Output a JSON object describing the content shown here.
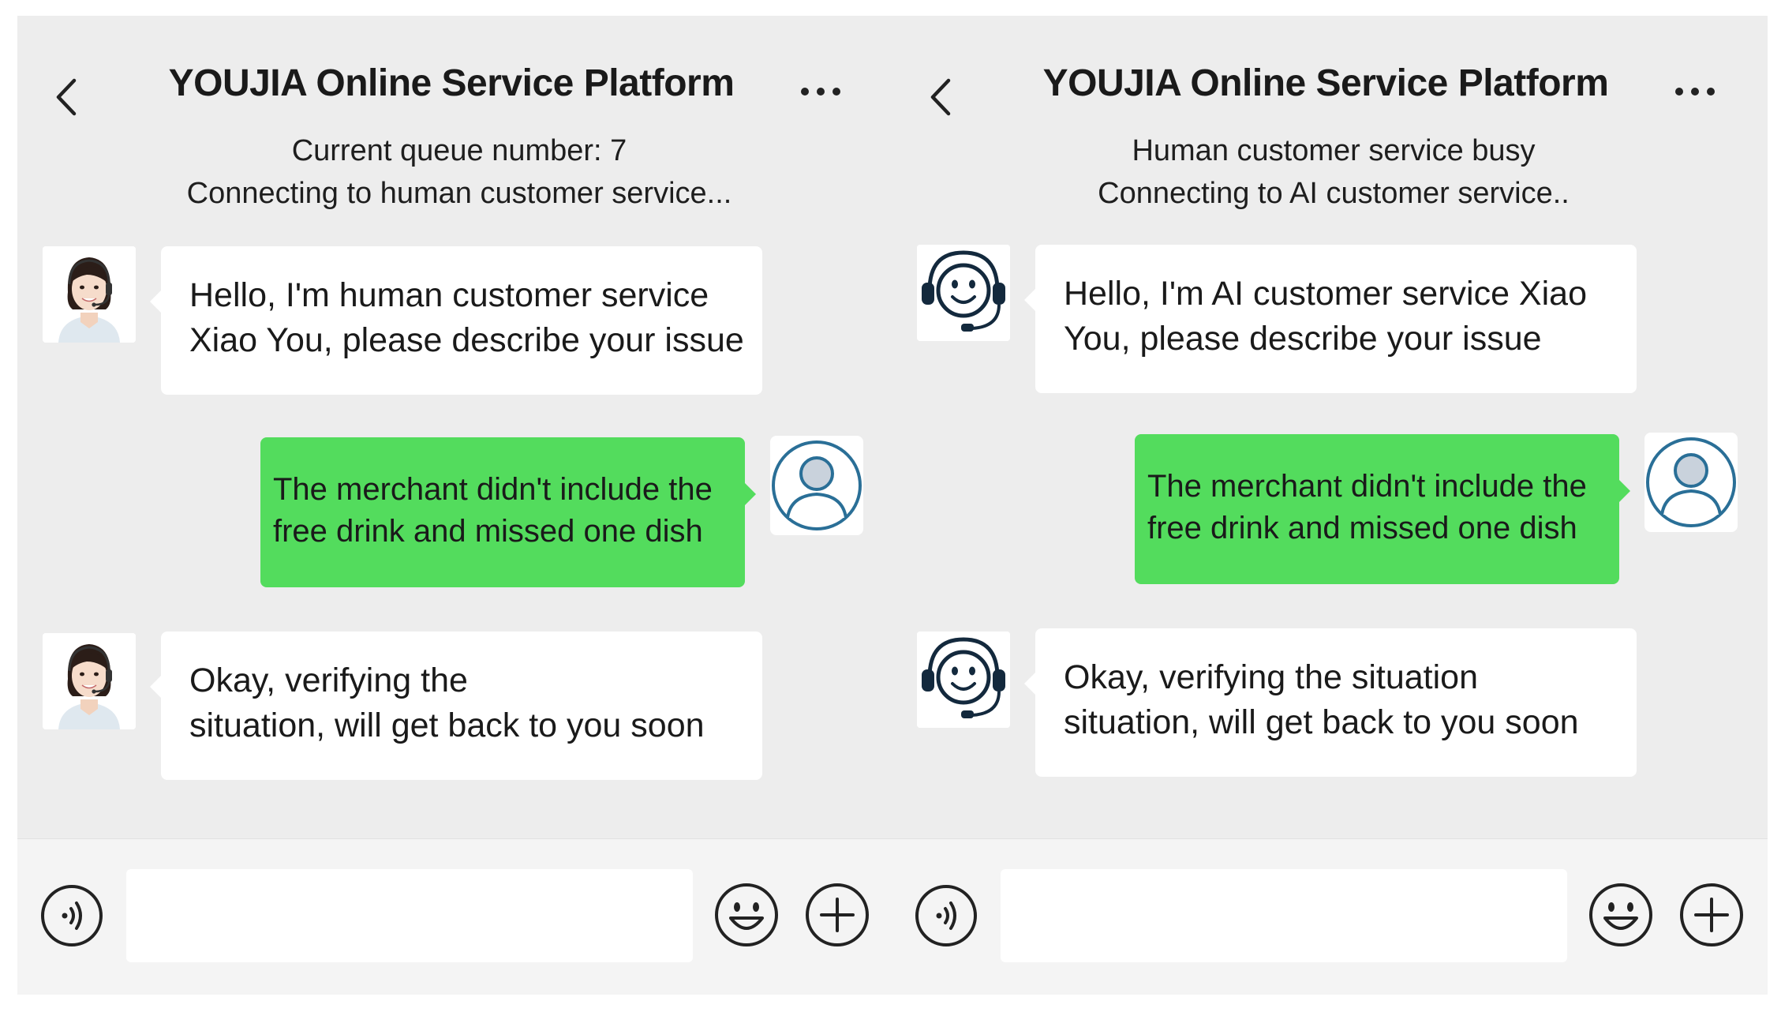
{
  "panels": [
    {
      "title": "YOUJIA Online Service Platform",
      "status_lines": [
        "Current queue number: 7",
        "Connecting to human customer service..."
      ],
      "agent_type": "human",
      "messages": [
        {
          "from": "agent",
          "lines": [
            "Hello, I'm human customer service",
            "Xiao You, please describe your issue"
          ]
        },
        {
          "from": "user",
          "lines": [
            "The merchant didn't include the",
            "free drink and missed one dish"
          ]
        },
        {
          "from": "agent",
          "lines": [
            "Okay, verifying the",
            "situation, will get back to you soon"
          ]
        }
      ],
      "input": {
        "value": "",
        "placeholder": ""
      }
    },
    {
      "title": "YOUJIA Online Service Platform",
      "status_lines": [
        "Human customer service busy",
        "Connecting to AI customer service.."
      ],
      "agent_type": "ai",
      "messages": [
        {
          "from": "agent",
          "lines": [
            "Hello, I'm AI customer service Xiao",
            "You, please describe your issue"
          ]
        },
        {
          "from": "user",
          "lines": [
            "The merchant didn't include the",
            "free drink and missed one dish"
          ]
        },
        {
          "from": "agent",
          "lines": [
            "Okay, verifying the situation",
            "situation, will get back to you soon"
          ]
        }
      ],
      "input": {
        "value": "",
        "placeholder": ""
      }
    }
  ],
  "icons": {
    "back": "chevron-left-icon",
    "more": "more-dots-icon",
    "voice": "voice-icon",
    "emoji": "emoji-icon",
    "plus": "plus-icon",
    "human_agent": "human-agent-avatar",
    "ai_agent": "headset-smiley-icon",
    "user": "user-icon"
  },
  "colors": {
    "panel_bg": "#ededed",
    "user_bubble": "#53dc5d",
    "agent_bubble": "#ffffff",
    "user_icon": "#2a6f97",
    "ai_icon": "#13293d",
    "text": "#1a1a1a"
  }
}
